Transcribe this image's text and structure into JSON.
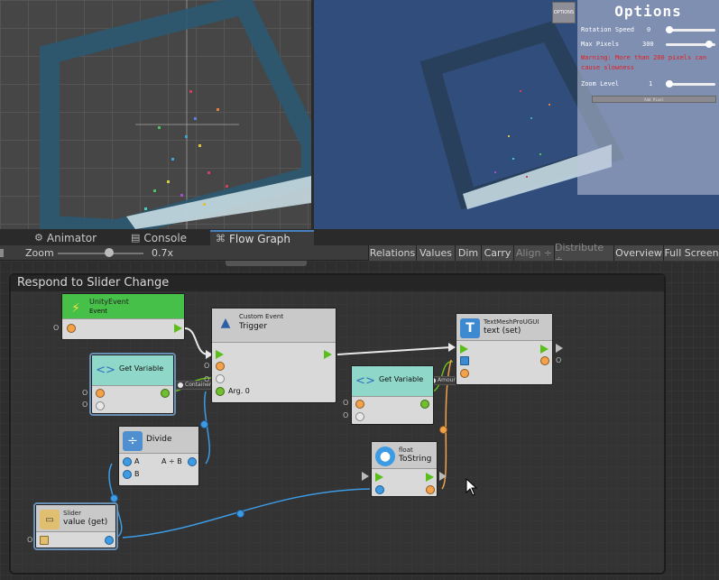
{
  "options": {
    "icon_label": "OPTIONS",
    "title": "Options",
    "rotation_speed_label": "Rotation Speed",
    "rotation_speed_value": "0",
    "max_pixels_label": "Max Pixels",
    "max_pixels_value": "300",
    "warning_text": "Warning: More than 200 pixels can cause slowness",
    "zoom_level_label": "Zoom Level",
    "zoom_level_value": "1",
    "button_label": "Add Pixel"
  },
  "tabs": [
    {
      "label": "Animator",
      "icon": "animator-icon"
    },
    {
      "label": "Console",
      "icon": "console-icon"
    },
    {
      "label": "Flow Graph",
      "icon": "flow-graph-icon"
    }
  ],
  "toolbar": {
    "zoom_label": "Zoom",
    "zoom_value": "0.7x",
    "buttons": [
      "Relations",
      "Values",
      "Dim",
      "Carry",
      "Align ÷",
      "Distribute ÷",
      "Overview",
      "Full Screen"
    ]
  },
  "graph": {
    "group_title": "Respond to Slider Change",
    "nodes": {
      "unity_event": {
        "subtitle": "UnityEvent",
        "title": "Event",
        "port_label": "O"
      },
      "custom_event": {
        "subtitle": "Custom Event",
        "title": "Trigger",
        "arg_label": "Arg. 0"
      },
      "get_variable_1": {
        "title": "Get Variable"
      },
      "get_variable_2": {
        "title": "Get Variable"
      },
      "text_mesh": {
        "subtitle": "TextMeshProUGUI",
        "title": "text (set)"
      },
      "divide": {
        "title": "Divide",
        "a_label": "A",
        "b_label": "B",
        "op_label": "A ÷ B"
      },
      "to_string": {
        "subtitle": "float",
        "title": "ToString"
      },
      "slider": {
        "subtitle": "Slider",
        "title": "value (get)"
      }
    },
    "relays": {
      "container": "Container",
      "amount": "Amount"
    },
    "colors": {
      "flow": "#6abd1c",
      "float": "#3d9be4",
      "object": "#f3a14a"
    }
  }
}
